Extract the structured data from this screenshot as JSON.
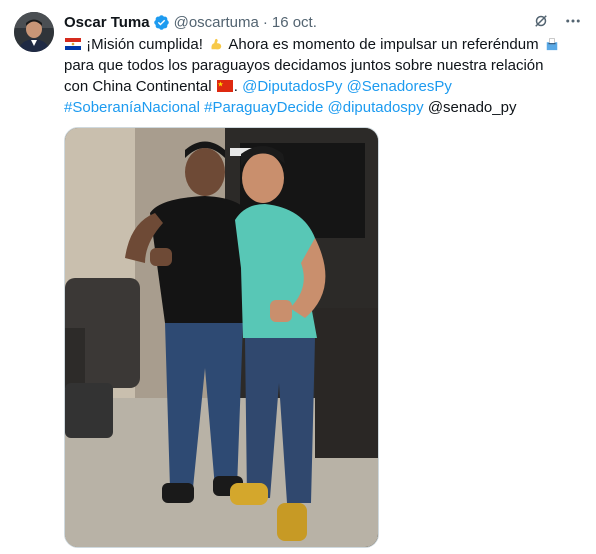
{
  "tweet": {
    "author_name": "Oscar Tuma",
    "handle": "@oscartuma",
    "separator": "·",
    "date": "16 oct.",
    "text": {
      "line1_a": "¡Misión cumplida!",
      "line1_b": "Ahora es momento de impulsar un referéndum",
      "line2": "para que todos los paraguayos decidamos juntos sobre nuestra relación",
      "line3_a": "con China Continental",
      "line3_b": ".",
      "mention_diputados": "@DiputadosPy",
      "mention_senadores": "@SenadoresPy",
      "hashtag_soberania": "#SoberaníaNacional",
      "hashtag_paraguay": "#ParaguayDecide",
      "mention_diputadospy": "@diputadospy",
      "mention_senado": "@senado_py"
    },
    "emojis": [
      "paraguay-flag-icon",
      "flexed-biceps-icon",
      "ballot-box-icon",
      "china-flag-icon"
    ]
  },
  "colors": {
    "link": "#1d9bf0",
    "secondary_text": "#536471",
    "verified": "#1d9bf0"
  }
}
